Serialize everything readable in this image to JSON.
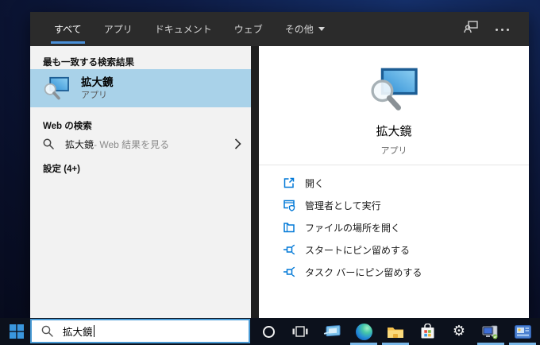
{
  "window": {
    "tabs": [
      {
        "label": "すべて",
        "selected": true
      },
      {
        "label": "アプリ",
        "selected": false
      },
      {
        "label": "ドキュメント",
        "selected": false
      },
      {
        "label": "ウェブ",
        "selected": false
      },
      {
        "label": "その他",
        "selected": false,
        "has_dropdown": true
      }
    ],
    "header_icons": [
      "user-account-icon",
      "more-options-icon"
    ],
    "accent_color": "#4a90d9",
    "header_bg": "#2b2b2b"
  },
  "left_panel": {
    "best_match_header": "最も一致する検索結果",
    "best_match": {
      "title": "拡大鏡",
      "subtitle": "アプリ",
      "icon": "magnifier-app-icon",
      "highlight_color": "#a9d2e9"
    },
    "web_header": "Web の検索",
    "web_item": {
      "query": "拡大鏡",
      "suffix": " - Web 結果を見る",
      "icon": "search-icon",
      "chevron": "chevron-right-icon"
    },
    "settings_header": "設定 (4+)"
  },
  "right_panel": {
    "app_title": "拡大鏡",
    "app_subtitle": "アプリ",
    "app_icon": "magnifier-app-icon",
    "action_icon_color": "#0078d7",
    "actions": [
      {
        "label": "開く",
        "icon": "open-icon"
      },
      {
        "label": "管理者として実行",
        "icon": "run-as-admin-icon"
      },
      {
        "label": "ファイルの場所を開く",
        "icon": "open-file-location-icon"
      },
      {
        "label": "スタートにピン留めする",
        "icon": "pin-to-start-icon"
      },
      {
        "label": "タスク バーにピン留めする",
        "icon": "pin-to-taskbar-icon"
      }
    ]
  },
  "taskbar": {
    "bg_color": "#0c111c",
    "search_value": "拡大鏡",
    "running_indicator_color": "#79b7e8",
    "icons": [
      {
        "name": "windows-start-icon",
        "running": false
      },
      {
        "name": "cortana-icon",
        "running": false
      },
      {
        "name": "task-view-icon",
        "running": false
      },
      {
        "name": "app-window-icon",
        "running": false
      },
      {
        "name": "edge-icon",
        "running": true
      },
      {
        "name": "file-explorer-icon",
        "running": true
      },
      {
        "name": "microsoft-store-icon",
        "running": false
      },
      {
        "name": "settings-icon",
        "running": false
      },
      {
        "name": "my-computer-icon",
        "running": true
      },
      {
        "name": "blue-app-icon",
        "running": true
      }
    ]
  }
}
